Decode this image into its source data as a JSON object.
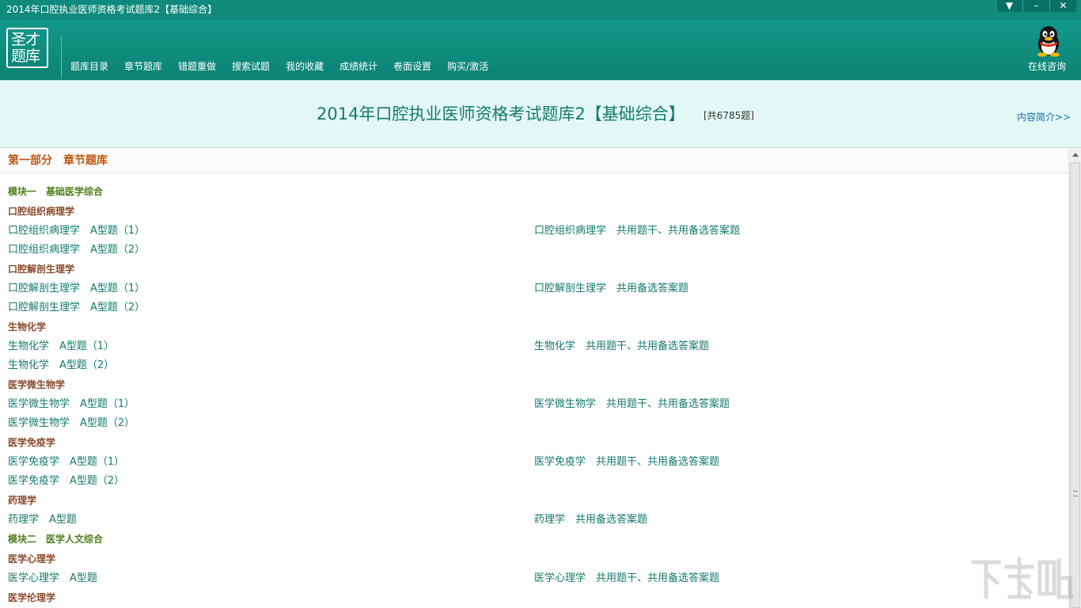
{
  "window": {
    "title": "2014年口腔执业医师资格考试题库2【基础综合】",
    "controls": {
      "menu": "▼",
      "minimize": "–",
      "close": "✕"
    }
  },
  "logo": {
    "line1": "圣才",
    "line2": "题库"
  },
  "nav": {
    "items": [
      "题库目录",
      "章节题库",
      "错题重做",
      "搜索试题",
      "我的收藏",
      "成绩统计",
      "卷面设置",
      "购买/激活"
    ],
    "consult_label": "在线咨询",
    "consult_icon": "qq-penguin-icon"
  },
  "banner": {
    "title": "2014年口腔执业医师资格考试题库2【基础综合】",
    "count": "[共6785题]",
    "intro_link": "内容简介>>"
  },
  "section": {
    "title": "第一部分　章节题库"
  },
  "content": {
    "rows": [
      {
        "kind": "module",
        "text": "模块一　基础医学综合"
      },
      {
        "kind": "subject",
        "text": "口腔组织病理学"
      },
      {
        "kind": "links",
        "left": "口腔组织病理学　A型题（1）",
        "right": "口腔组织病理学　共用题干、共用备选答案题"
      },
      {
        "kind": "links",
        "left": "口腔组织病理学　A型题（2）",
        "right": ""
      },
      {
        "kind": "subject",
        "text": "口腔解剖生理学"
      },
      {
        "kind": "links",
        "left": "口腔解剖生理学　A型题（1）",
        "right": "口腔解剖生理学　共用备选答案题"
      },
      {
        "kind": "links",
        "left": "口腔解剖生理学　A型题（2）",
        "right": ""
      },
      {
        "kind": "subject",
        "text": "生物化学"
      },
      {
        "kind": "links",
        "left": "生物化学　A型题（1）",
        "right": "生物化学　共用题干、共用备选答案题"
      },
      {
        "kind": "links",
        "left": "生物化学　A型题（2）",
        "right": ""
      },
      {
        "kind": "subject",
        "text": "医学微生物学"
      },
      {
        "kind": "links",
        "left": "医学微生物学　A型题（1）",
        "right": "医学微生物学　共用题干、共用备选答案题"
      },
      {
        "kind": "links",
        "left": "医学微生物学　A型题（2）",
        "right": ""
      },
      {
        "kind": "subject",
        "text": "医学免疫学"
      },
      {
        "kind": "links",
        "left": "医学免疫学　A型题（1）",
        "right": "医学免疫学　共用题干、共用备选答案题"
      },
      {
        "kind": "links",
        "left": "医学免疫学　A型题（2）",
        "right": ""
      },
      {
        "kind": "subject",
        "text": "药理学"
      },
      {
        "kind": "links",
        "left": "药理学　A型题",
        "right": "药理学　共用备选答案题"
      },
      {
        "kind": "module",
        "text": "模块二　医学人文综合"
      },
      {
        "kind": "subject",
        "text": "医学心理学"
      },
      {
        "kind": "links",
        "left": "医学心理学　A型题",
        "right": "医学心理学　共用题干、共用备选答案题"
      },
      {
        "kind": "subject",
        "text": "医学伦理学"
      }
    ]
  },
  "colors": {
    "titlebar": "#0f8a7c",
    "navbar": "#13988a",
    "banner_bg": "#e3f8f5",
    "banner_title": "#147a6e",
    "section_title": "#c0560f",
    "module_text": "#4f7f1c",
    "subject_text": "#8b4a2b",
    "link_text": "#137a6b"
  }
}
